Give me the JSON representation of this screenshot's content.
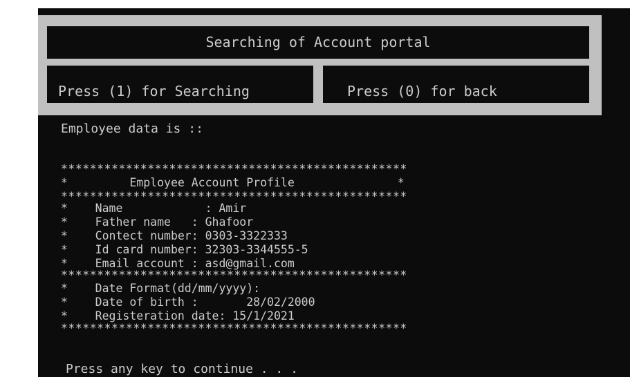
{
  "portal": {
    "title": "Searching of Account portal",
    "search_label": "Press (1) for Searching",
    "back_label": "Press (0) for back"
  },
  "output": {
    "heading": "Employee data is ::",
    "stars": "************************************************",
    "profile_title": "*         Employee Account Profile               *",
    "fields": [
      "*    Name            : Amir",
      "*    Father name   : Ghafoor",
      "*    Contect number: 0303-3322333",
      "*    Id card number: 32303-3344555-5",
      "*    Email account : asd@gmail.com"
    ],
    "dates": [
      "*    Date Format(dd/mm/yyyy):",
      "*    Date of birth :       28/02/2000",
      "*    Registeration date: 15/1/2021"
    ],
    "continue_prompt": "Press any key to continue . . ."
  },
  "colors": {
    "console_bg": "#0c0c0c",
    "console_text": "#cccccc",
    "frame": "#c0c0c0"
  }
}
